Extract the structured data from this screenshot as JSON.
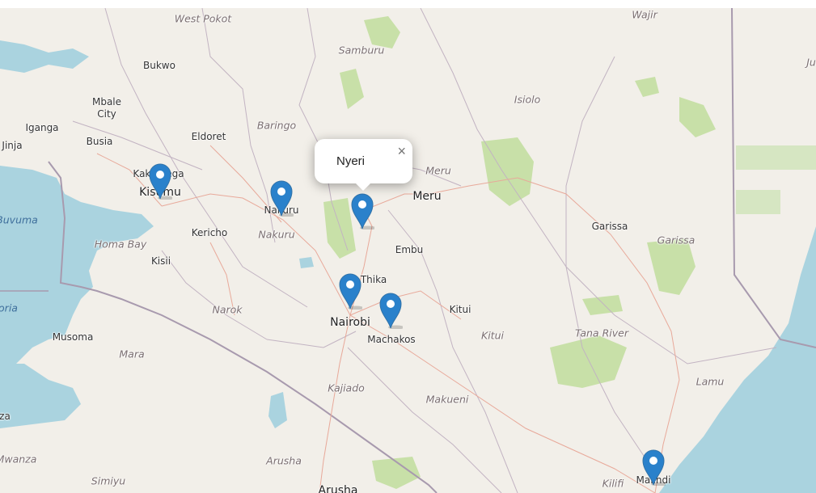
{
  "map": {
    "labels": [
      {
        "text": "West Pokot",
        "style": "region"
      },
      {
        "text": "Samburu",
        "style": "region"
      },
      {
        "text": "Wajir",
        "style": "region"
      },
      {
        "text": "Ju",
        "style": "region"
      },
      {
        "text": "Bukwo",
        "style": "town"
      },
      {
        "text": "Mbale",
        "style": "town"
      },
      {
        "text": "City",
        "style": "town"
      },
      {
        "text": "Iganga",
        "style": "town"
      },
      {
        "text": "Jinja",
        "style": "town"
      },
      {
        "text": "Busia",
        "style": "town"
      },
      {
        "text": "Eldoret",
        "style": "town"
      },
      {
        "text": "Baringo",
        "style": "region"
      },
      {
        "text": "Isiolo",
        "style": "region"
      },
      {
        "text": "Meru",
        "style": "region"
      },
      {
        "text": "Meru",
        "style": "city"
      },
      {
        "text": "Kakamega",
        "style": "town"
      },
      {
        "text": "Kisumu",
        "style": "city"
      },
      {
        "text": "Nakuru",
        "style": "town"
      },
      {
        "text": "Nakuru",
        "style": "region"
      },
      {
        "text": "Kericho",
        "style": "town"
      },
      {
        "text": "Buvuma",
        "style": "water"
      },
      {
        "text": "Homa Bay",
        "style": "region"
      },
      {
        "text": "Kisii",
        "style": "town"
      },
      {
        "text": "Embu",
        "style": "town"
      },
      {
        "text": "Garissa",
        "style": "town"
      },
      {
        "text": "Garissa",
        "style": "region"
      },
      {
        "text": "Thika",
        "style": "town"
      },
      {
        "text": "Narok",
        "style": "region"
      },
      {
        "text": "Nairobi",
        "style": "city"
      },
      {
        "text": "Kitui",
        "style": "town"
      },
      {
        "text": "Kitui",
        "style": "region"
      },
      {
        "text": "Machakos",
        "style": "town"
      },
      {
        "text": "Tana River",
        "style": "region"
      },
      {
        "text": "oria",
        "style": "water"
      },
      {
        "text": "Musoma",
        "style": "town"
      },
      {
        "text": "Mara",
        "style": "region"
      },
      {
        "text": "Lamu",
        "style": "region"
      },
      {
        "text": "Kajiado",
        "style": "region"
      },
      {
        "text": "Makueni",
        "style": "region"
      },
      {
        "text": "za",
        "style": "town"
      },
      {
        "text": "Arusha",
        "style": "region"
      },
      {
        "text": "Mwanza",
        "style": "region"
      },
      {
        "text": "Simiyu",
        "style": "region"
      },
      {
        "text": "Arusha",
        "style": "city"
      },
      {
        "text": "Kilifi",
        "style": "region"
      },
      {
        "text": "Malindi",
        "style": "town"
      }
    ],
    "markers": [
      {
        "name": "Kisumu"
      },
      {
        "name": "Nakuru"
      },
      {
        "name": "Nyeri"
      },
      {
        "name": "Nairobi"
      },
      {
        "name": "Machakos"
      },
      {
        "name": "Malindi"
      }
    ],
    "popup": {
      "text": "Nyeri",
      "close_symbol": "×"
    },
    "colors": {
      "land": "#f2efe9",
      "water": "#aad3df",
      "park": "#c8e0a8",
      "border": "#a89aae",
      "marker": "#2a81cb"
    }
  }
}
